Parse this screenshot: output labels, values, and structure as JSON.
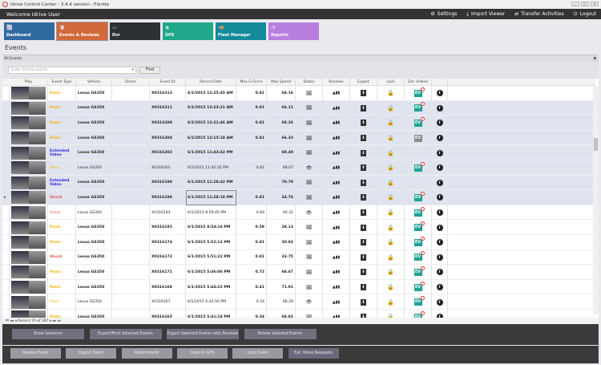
{
  "window": {
    "title": "Idrive Control Center - 3.4.4 version - Florida"
  },
  "topbar": {
    "welcome": "Welcome Idrive User",
    "nav": [
      {
        "label": "Settings",
        "icon": "gears-icon"
      },
      {
        "label": "Import Viewer",
        "icon": "download-icon"
      },
      {
        "label": "Transfer Activities",
        "icon": "transfer-icon"
      },
      {
        "label": "Logout",
        "icon": "power-icon"
      }
    ]
  },
  "tiles": [
    {
      "label": "Dashboard",
      "color": "#2f6aa0"
    },
    {
      "label": "Events & Reviews",
      "color": "#d2693a"
    },
    {
      "label": "Dvr",
      "color": "#2d3035"
    },
    {
      "label": "GPS",
      "color": "#1fa88a"
    },
    {
      "label": "Fleet Manager",
      "color": "#138a9a"
    },
    {
      "label": "Reports",
      "color": "#b77ee0"
    }
  ],
  "page_title": "Events",
  "group_label": "All Events",
  "search": {
    "placeholder": "Enter text to search...",
    "find": "Find"
  },
  "columns": [
    "Play",
    "Event Type",
    "Vehicle",
    "Driver",
    "Event ID",
    "Record Date",
    "Max G-Force",
    "Max Speed",
    "Status",
    "Reviews",
    "Export",
    "Lock",
    "Ext. Videos",
    ""
  ],
  "colors": {
    "panic": "#f0b400",
    "shock": "#e9584a",
    "extended": "#2a2ae0",
    "ev": "#1fa294",
    "ev_gray": "#8a8a8a"
  },
  "rows": [
    {
      "type": "Panic",
      "vehicle": "Lexus GS350",
      "id": "X0316213",
      "date": "6/2/2015 12:25:45 AM",
      "g": "0.81",
      "speed": "68.16",
      "bold": true,
      "status": "image",
      "ev": "teal",
      "hl": false
    },
    {
      "type": "Panic",
      "vehicle": "Lexus GS350",
      "id": "X0316211",
      "date": "6/2/2015 12:23:21 AM",
      "g": "0.81",
      "speed": "66.11",
      "bold": true,
      "status": "image",
      "ev": "teal",
      "hl": true
    },
    {
      "type": "Panic",
      "vehicle": "Lexus GS350",
      "id": "X0316209",
      "date": "6/2/2015 12:21:46 AM",
      "g": "0.81",
      "speed": "68.26",
      "bold": true,
      "status": "image",
      "ev": "teal",
      "hl": true
    },
    {
      "type": "Panic",
      "vehicle": "Lexus GS350",
      "id": "X0316204",
      "date": "6/2/2015 12:15:18 AM",
      "g": "0.81",
      "speed": "66.33",
      "bold": true,
      "status": "image",
      "ev": "gray",
      "hl": true
    },
    {
      "type": "Extended Video",
      "vehicle": "Lexus GS350",
      "id": "X0316203",
      "date": "6/1/2015 11:43:42 PM",
      "g": "",
      "speed": "69.40",
      "bold": true,
      "status": "image",
      "ev": "",
      "hl": true
    },
    {
      "type": "Panic",
      "vehicle": "Lexus GS350",
      "id": "X0316201",
      "date": "6/1/2015 11:42:32 PM",
      "g": "0.81",
      "speed": "68.07",
      "bold": false,
      "status": "eye",
      "ev": "teal",
      "hl": true
    },
    {
      "type": "Extended Video",
      "vehicle": "Lexus GS350",
      "id": "X0316198",
      "date": "6/1/2015 11:28:42 PM",
      "g": "",
      "speed": "70.70",
      "bold": true,
      "status": "image",
      "ev": "",
      "hl": true
    },
    {
      "type": "Shock",
      "vehicle": "Lexus GS350",
      "id": "X0316196",
      "date": "6/1/2015 11:28:18 PM",
      "g": "0.81",
      "speed": "24.76",
      "bold": true,
      "status": "image",
      "ev": "teal",
      "hl": true,
      "current": true
    },
    {
      "type": "Shock",
      "vehicle": "Lexus GS350",
      "id": "X0316193",
      "date": "6/1/2015 8:59:45 PM",
      "g": "0.84",
      "speed": "40.31",
      "bold": false,
      "status": "eye",
      "ev": "teal",
      "hl": false
    },
    {
      "type": "Panic",
      "vehicle": "Lexus GS350",
      "id": "X0316191",
      "date": "6/1/2015 8:54:10 PM",
      "g": "0.59",
      "speed": "28.13",
      "bold": true,
      "status": "image",
      "ev": "teal",
      "hl": false
    },
    {
      "type": "Panic",
      "vehicle": "Lexus GS350",
      "id": "X0316174",
      "date": "6/1/2015 5:52:13 PM",
      "g": "0.81",
      "speed": "30.83",
      "bold": true,
      "status": "image",
      "ev": "teal",
      "hl": false
    },
    {
      "type": "Shock",
      "vehicle": "Lexus GS350",
      "id": "X0316172",
      "date": "6/1/2015 5:51:22 PM",
      "g": "0.81",
      "speed": "33.75",
      "bold": true,
      "status": "image",
      "ev": "teal",
      "hl": false
    },
    {
      "type": "Panic",
      "vehicle": "Lexus GS350",
      "id": "X0316171",
      "date": "6/1/2015 5:46:06 PM",
      "g": "0.72",
      "speed": "68.67",
      "bold": true,
      "status": "image",
      "ev": "teal",
      "hl": false
    },
    {
      "type": "Panic",
      "vehicle": "Lexus GS350",
      "id": "X0316169",
      "date": "6/1/2015 5:44:23 PM",
      "g": "0.41",
      "speed": "71.91",
      "bold": true,
      "status": "image",
      "ev": "teal",
      "hl": false
    },
    {
      "type": "Panic",
      "vehicle": "Lexus GS350",
      "id": "X0316167",
      "date": "6/1/2015 5:43:56 PM",
      "g": "0.34",
      "speed": "68.29",
      "bold": false,
      "status": "eye",
      "ev": "teal",
      "hl": false
    },
    {
      "type": "Panic",
      "vehicle": "Lexus GS350",
      "id": "X0316165",
      "date": "6/1/2015 5:41:18 PM",
      "g": "0.34",
      "speed": "68.82",
      "bold": true,
      "status": "image",
      "ev": "teal",
      "hl": false
    }
  ],
  "pager": {
    "text": "Record 70 of 287"
  },
  "actions1": [
    "Show Selection",
    "Export/Print Selected Events",
    "Export Selected Events with Reviews",
    "Delete Selected  Events"
  ],
  "actions2": [
    "Review Event",
    "Export Event",
    "Attachments",
    "Open in GPS",
    "Lock Event",
    "Ext. Video Requests"
  ]
}
